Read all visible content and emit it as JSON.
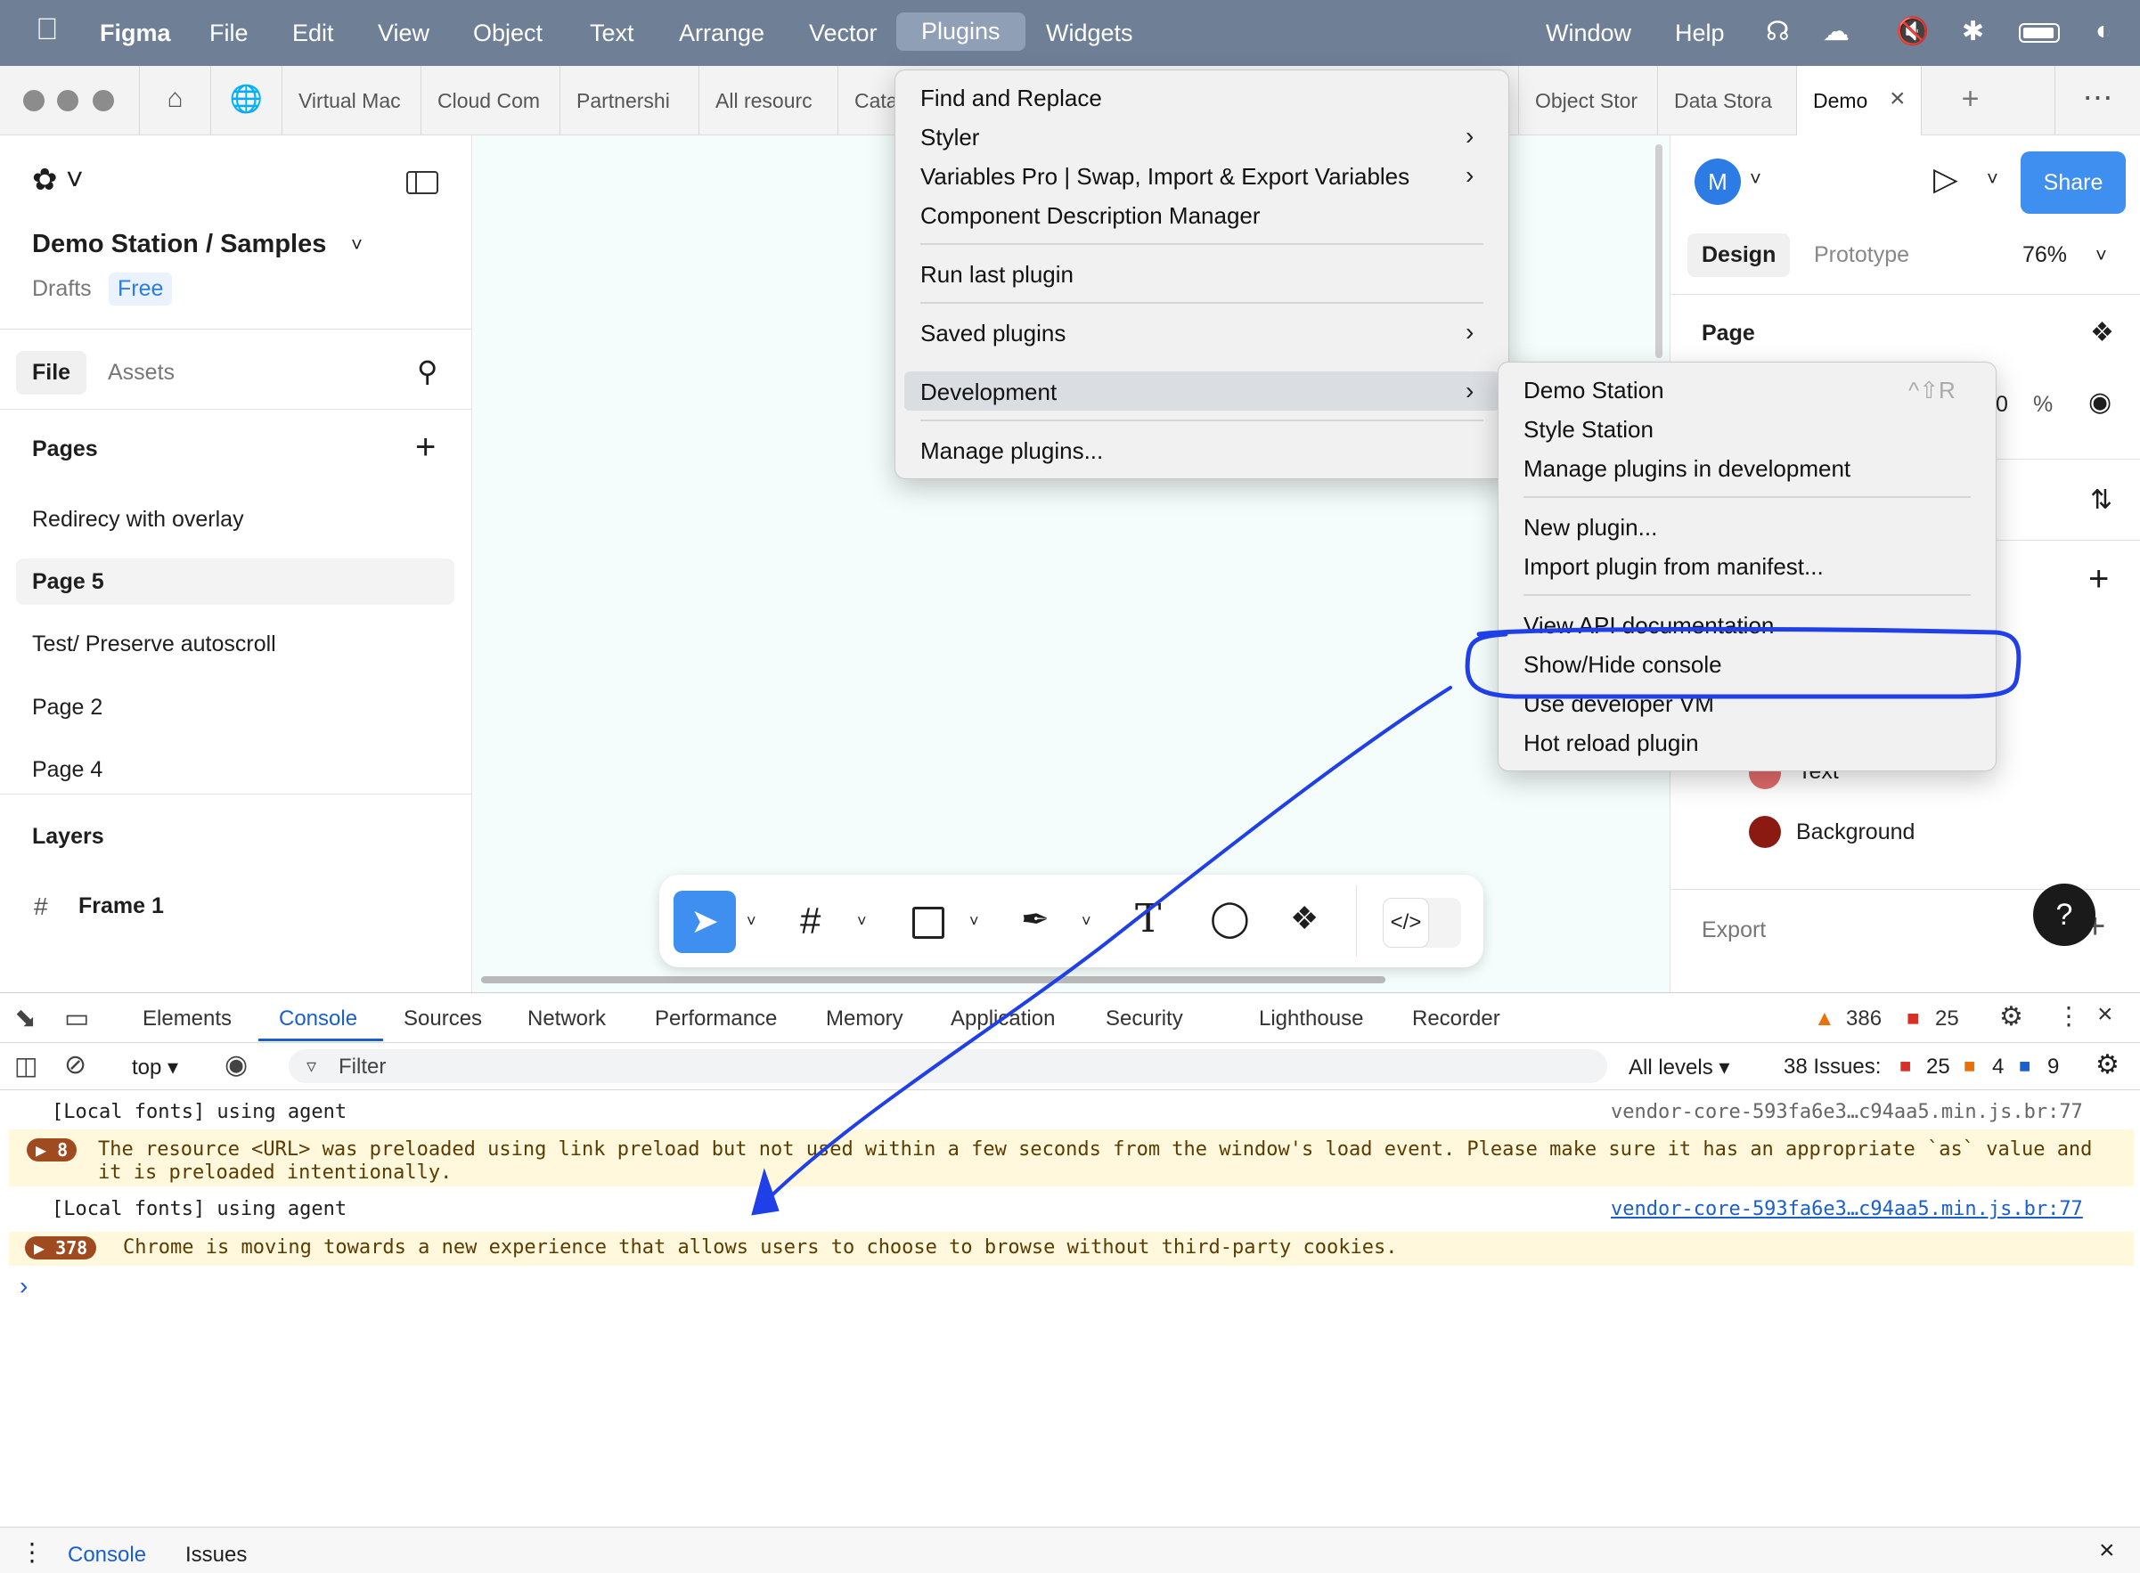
{
  "menubar": {
    "app": "Figma",
    "items": [
      "File",
      "Edit",
      "View",
      "Object",
      "Text",
      "Arrange",
      "Vector",
      "Plugins",
      "Widgets"
    ],
    "right_items": [
      "Window",
      "Help"
    ]
  },
  "tabs": [
    "Virtual Mac",
    "Cloud Com",
    "Partnershi",
    "All resourc",
    "Cata",
    "Object Stor",
    "Data Stora",
    "Demo"
  ],
  "left": {
    "file_title": "Demo Station / Samples",
    "drafts": "Drafts",
    "plan": "Free",
    "tab_file": "File",
    "tab_assets": "Assets",
    "pages_header": "Pages",
    "pages": [
      "Redirecy with overlay",
      "Page 5",
      "Test/ Preserve autoscroll",
      "Page 2",
      "Page 4"
    ],
    "layers_header": "Layers",
    "layers": [
      "Frame 1"
    ]
  },
  "right": {
    "avatar": "M",
    "share": "Share",
    "tab_design": "Design",
    "tab_prototype": "Prototype",
    "zoom": "76%",
    "page_label": "Page",
    "fill_pct": "0",
    "pct_sign": "%",
    "color_text": "Text",
    "color_background": "Background",
    "export_label": "Export",
    "help": "?",
    "colors": {
      "text_swatch": "#e06a6a",
      "bg_swatch": "#8b1a12"
    }
  },
  "plugins_menu": {
    "items": [
      "Find and Replace",
      "Styler",
      "Variables Pro | Swap, Import & Export Variables",
      "Component Description Manager",
      "Run last plugin",
      "Saved plugins",
      "Development",
      "Manage plugins..."
    ]
  },
  "dev_menu": {
    "items": [
      "Demo Station",
      "Style Station",
      "Manage plugins in development",
      "New plugin...",
      "Import plugin from manifest...",
      "View API documentation",
      "Show/Hide console",
      "Use developer VM",
      "Hot reload plugin"
    ],
    "shortcut": "^⇧R"
  },
  "devtools": {
    "tabs": [
      "Elements",
      "Console",
      "Sources",
      "Network",
      "Performance",
      "Memory",
      "Application",
      "Security",
      "Lighthouse",
      "Recorder"
    ],
    "warn_count": "386",
    "err_count": "25",
    "context": "top ▾",
    "filter_placeholder": "Filter",
    "levels": "All levels ▾",
    "issues_label": "38 Issues:",
    "issues_err": "25",
    "issues_warn": "4",
    "issues_info": "9",
    "logs": [
      {
        "text": "[Local fonts] using agent",
        "source": "vendor-core-593fa6e3…c94aa5.min.js.br:77"
      },
      {
        "badge": "8",
        "text": "The resource <URL> was preloaded using link preload but not used within a few seconds from the window's load event. Please make sure it has an appropriate `as` value and",
        "text2": "it is preloaded intentionally."
      },
      {
        "text": "[Local fonts] using agent",
        "source": "vendor-core-593fa6e3…c94aa5.min.js.br:77"
      },
      {
        "badge": "378",
        "text": "Chrome is moving towards a new experience that allows users to choose to browse without third-party cookies."
      }
    ],
    "prompt": "›",
    "drawer_console": "Console",
    "drawer_issues": "Issues"
  }
}
